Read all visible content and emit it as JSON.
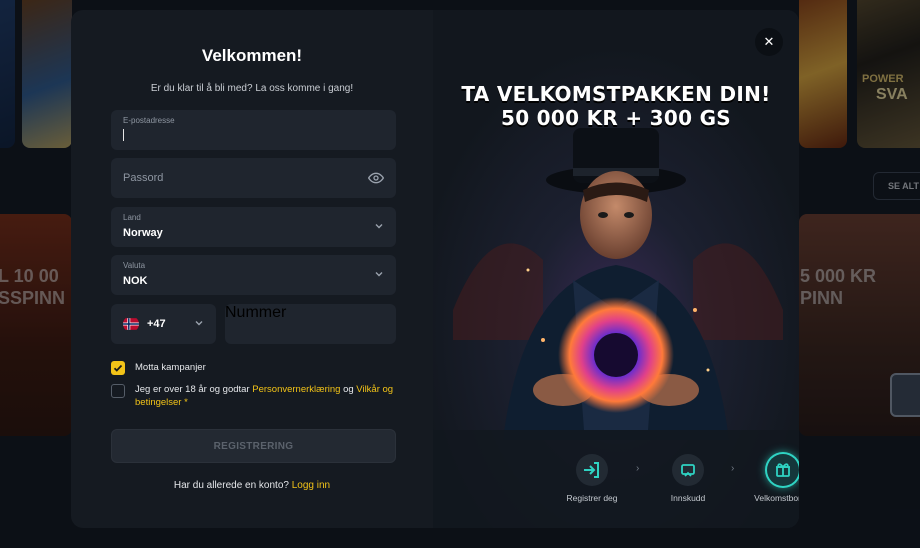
{
  "background": {
    "left_promo_line1": "L 10 00",
    "left_promo_line2": "SSPINN",
    "right_promo_line1": "5 000 KR",
    "right_promo_line2": "PINN",
    "see_all_label": "SE ALT",
    "game_label_top_right": "POWER",
    "game_label_top_right2": "SVA"
  },
  "modal": {
    "close_icon": "close-icon",
    "title": "Velkommen!",
    "subtitle": "Er du klar til å bli med? La oss komme i gang!",
    "fields": {
      "email": {
        "label": "E-postadresse",
        "value": ""
      },
      "password": {
        "placeholder": "Passord",
        "icon": "eye-icon"
      },
      "country": {
        "label": "Land",
        "value": "Norway"
      },
      "currency": {
        "label": "Valuta",
        "value": "NOK"
      },
      "phone_code": {
        "value": "+47",
        "flag": "norway-flag"
      },
      "phone_number": {
        "placeholder": "Nummer"
      }
    },
    "checkbox_promo": {
      "label": "Motta kampanjer",
      "checked": true
    },
    "checkbox_terms": {
      "text_before": "Jeg er over 18 år og godtar ",
      "link1": "Personvernerklæring",
      "text_middle": " og ",
      "link2": "Vilkår og betingelser",
      "required": " *",
      "checked": false
    },
    "register_button": "REGISTRERING",
    "login_prompt": "Har du allerede en konto?",
    "login_link": "Logg inn"
  },
  "promo": {
    "headline_line1": "TA VELKOMSTPAKKEN DIN!",
    "headline_line2": "50 000 KR + 300 GS",
    "steps": [
      {
        "label": "Registrer deg",
        "icon": "sign-in-icon",
        "active": false
      },
      {
        "label": "Innskudd",
        "icon": "wallet-icon",
        "active": false
      },
      {
        "label": "Velkomstbonus",
        "icon": "gift-icon",
        "active": true
      }
    ]
  },
  "colors": {
    "accent": "#f2c318",
    "active_step": "#2fd3c3",
    "modal_bg": "#151a21",
    "field_bg": "#1f252e"
  }
}
